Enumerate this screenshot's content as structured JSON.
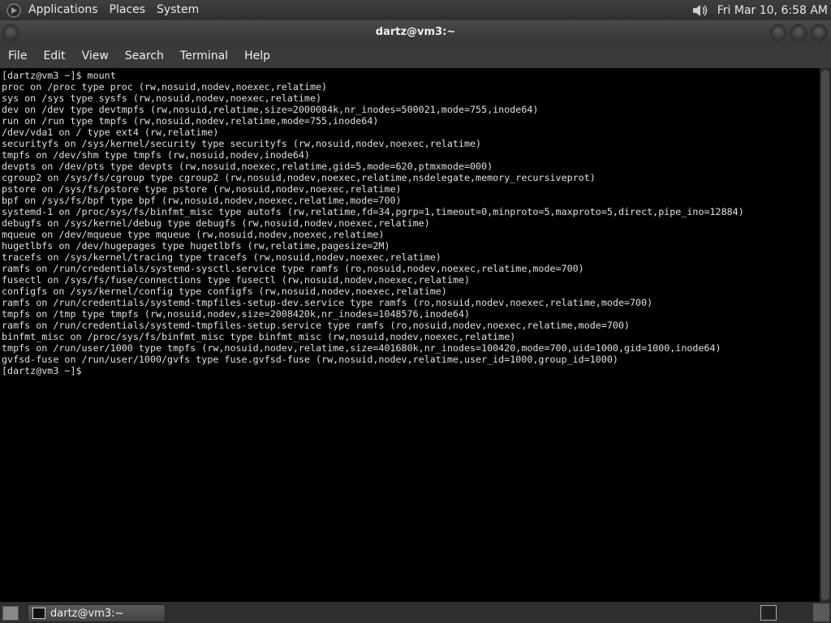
{
  "top_panel": {
    "menus": [
      "Applications",
      "Places",
      "System"
    ],
    "clock": "Fri Mar 10, 6:58 AM"
  },
  "window": {
    "title": "dartz@vm3:~"
  },
  "menubar": {
    "items": [
      "File",
      "Edit",
      "View",
      "Search",
      "Terminal",
      "Help"
    ]
  },
  "terminal": {
    "output": "[dartz@vm3 ~]$ mount\nproc on /proc type proc (rw,nosuid,nodev,noexec,relatime)\nsys on /sys type sysfs (rw,nosuid,nodev,noexec,relatime)\ndev on /dev type devtmpfs (rw,nosuid,relatime,size=2000084k,nr_inodes=500021,mode=755,inode64)\nrun on /run type tmpfs (rw,nosuid,nodev,relatime,mode=755,inode64)\n/dev/vda1 on / type ext4 (rw,relatime)\nsecurityfs on /sys/kernel/security type securityfs (rw,nosuid,nodev,noexec,relatime)\ntmpfs on /dev/shm type tmpfs (rw,nosuid,nodev,inode64)\ndevpts on /dev/pts type devpts (rw,nosuid,noexec,relatime,gid=5,mode=620,ptmxmode=000)\ncgroup2 on /sys/fs/cgroup type cgroup2 (rw,nosuid,nodev,noexec,relatime,nsdelegate,memory_recursiveprot)\npstore on /sys/fs/pstore type pstore (rw,nosuid,nodev,noexec,relatime)\nbpf on /sys/fs/bpf type bpf (rw,nosuid,nodev,noexec,relatime,mode=700)\nsystemd-1 on /proc/sys/fs/binfmt_misc type autofs (rw,relatime,fd=34,pgrp=1,timeout=0,minproto=5,maxproto=5,direct,pipe_ino=12884)\ndebugfs on /sys/kernel/debug type debugfs (rw,nosuid,nodev,noexec,relatime)\nmqueue on /dev/mqueue type mqueue (rw,nosuid,nodev,noexec,relatime)\nhugetlbfs on /dev/hugepages type hugetlbfs (rw,relatime,pagesize=2M)\ntracefs on /sys/kernel/tracing type tracefs (rw,nosuid,nodev,noexec,relatime)\nramfs on /run/credentials/systemd-sysctl.service type ramfs (ro,nosuid,nodev,noexec,relatime,mode=700)\nfusectl on /sys/fs/fuse/connections type fusectl (rw,nosuid,nodev,noexec,relatime)\nconfigfs on /sys/kernel/config type configfs (rw,nosuid,nodev,noexec,relatime)\nramfs on /run/credentials/systemd-tmpfiles-setup-dev.service type ramfs (ro,nosuid,nodev,noexec,relatime,mode=700)\ntmpfs on /tmp type tmpfs (rw,nosuid,nodev,size=2008420k,nr_inodes=1048576,inode64)\nramfs on /run/credentials/systemd-tmpfiles-setup.service type ramfs (ro,nosuid,nodev,noexec,relatime,mode=700)\nbinfmt_misc on /proc/sys/fs/binfmt_misc type binfmt_misc (rw,nosuid,nodev,noexec,relatime)\ntmpfs on /run/user/1000 type tmpfs (rw,nosuid,nodev,relatime,size=401680k,nr_inodes=100420,mode=700,uid=1000,gid=1000,inode64)\ngvfsd-fuse on /run/user/1000/gvfs type fuse.gvfsd-fuse (rw,nosuid,nodev,relatime,user_id=1000,group_id=1000)\n[dartz@vm3 ~]$"
  },
  "taskbar": {
    "task_label": "dartz@vm3:~"
  }
}
